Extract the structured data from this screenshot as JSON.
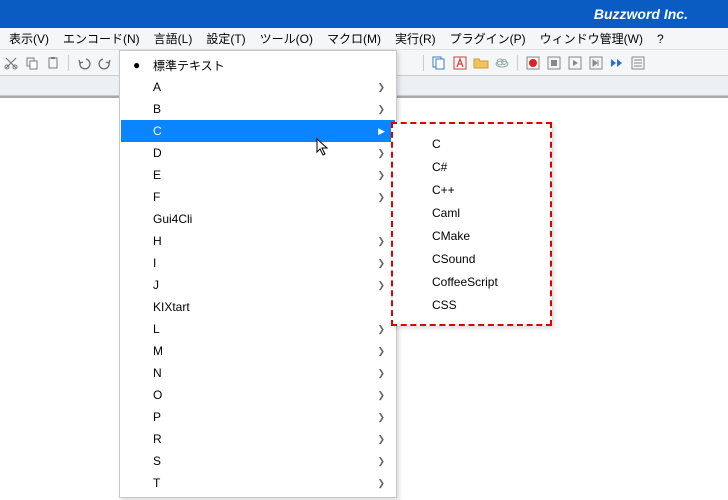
{
  "title_bar": {
    "brand": "Buzzword Inc."
  },
  "menu": {
    "items": [
      {
        "label": "表示(V)"
      },
      {
        "label": "エンコード(N)"
      },
      {
        "label": "言語(L)"
      },
      {
        "label": "設定(T)"
      },
      {
        "label": "ツール(O)"
      },
      {
        "label": "マクロ(M)"
      },
      {
        "label": "実行(R)"
      },
      {
        "label": "プラグイン(P)"
      },
      {
        "label": "ウィンドウ管理(W)"
      },
      {
        "label": "?"
      }
    ]
  },
  "toolbar_right_icons": [
    "copy",
    "adobe",
    "folder",
    "cloud",
    "record",
    "stop",
    "play-pause",
    "play-next",
    "fast-forward",
    "list"
  ],
  "language_menu": {
    "items": [
      {
        "label": "標準テキスト",
        "bullet": true
      },
      {
        "label": "A",
        "submenu": true
      },
      {
        "label": "B",
        "submenu": true
      },
      {
        "label": "C",
        "submenu": true,
        "highlighted": true
      },
      {
        "label": "D",
        "submenu": true
      },
      {
        "label": "E",
        "submenu": true
      },
      {
        "label": "F",
        "submenu": true
      },
      {
        "label": "Gui4Cli"
      },
      {
        "label": "H",
        "submenu": true
      },
      {
        "label": "I",
        "submenu": true
      },
      {
        "label": "J",
        "submenu": true
      },
      {
        "label": "KIXtart"
      },
      {
        "label": "L",
        "submenu": true
      },
      {
        "label": "M",
        "submenu": true
      },
      {
        "label": "N",
        "submenu": true
      },
      {
        "label": "O",
        "submenu": true
      },
      {
        "label": "P",
        "submenu": true
      },
      {
        "label": "R",
        "submenu": true
      },
      {
        "label": "S",
        "submenu": true
      },
      {
        "label": "T",
        "submenu": true
      }
    ]
  },
  "c_submenu": {
    "items": [
      {
        "label": "C"
      },
      {
        "label": "C#"
      },
      {
        "label": "C++"
      },
      {
        "label": "Caml"
      },
      {
        "label": "CMake"
      },
      {
        "label": "CSound"
      },
      {
        "label": "CoffeeScript"
      },
      {
        "label": "CSS"
      }
    ]
  }
}
